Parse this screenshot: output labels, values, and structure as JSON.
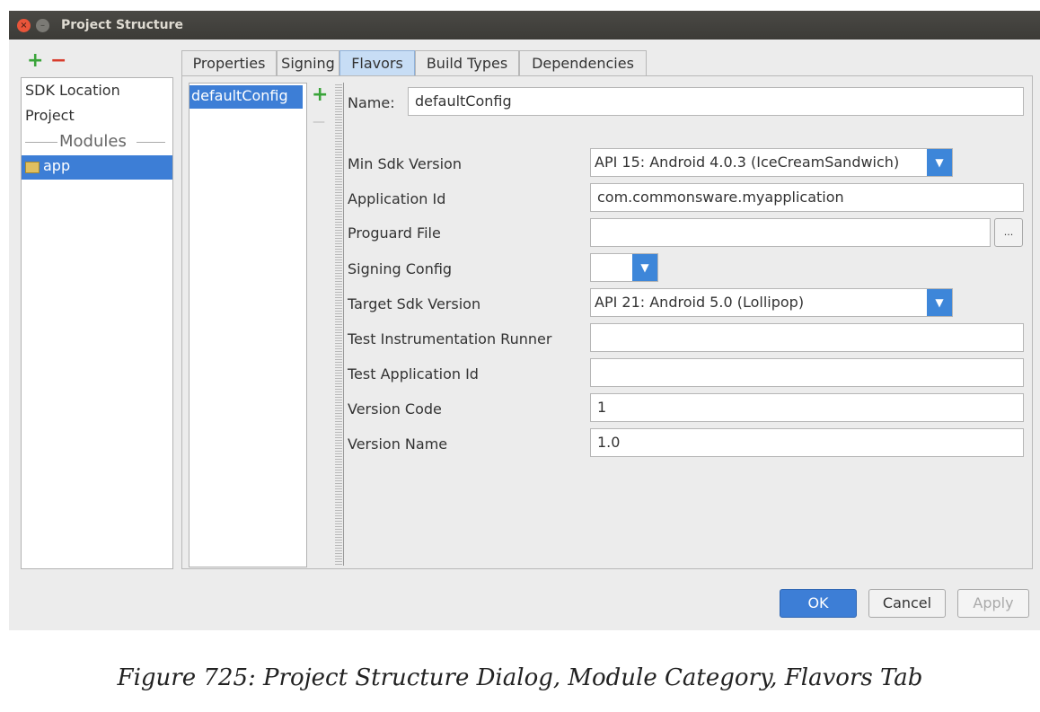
{
  "window": {
    "title": "Project Structure"
  },
  "categories": {
    "add_symbol": "+",
    "remove_symbol": "−",
    "items": [
      "SDK Location",
      "Project"
    ],
    "section_label": "Modules",
    "modules": [
      "app"
    ]
  },
  "tabs": [
    "Properties",
    "Signing",
    "Flavors",
    "Build Types",
    "Dependencies"
  ],
  "selected_tab": "Flavors",
  "flavors": {
    "items": [
      "defaultConfig"
    ],
    "add_symbol": "+",
    "remove_symbol": "—"
  },
  "form": {
    "name_label": "Name:",
    "name_value": "defaultConfig",
    "min_sdk_label": "Min Sdk Version",
    "min_sdk_value": "API 15: Android 4.0.3 (IceCreamSandwich)",
    "app_id_label": "Application Id",
    "app_id_value": "com.commonsware.myapplication",
    "proguard_label": "Proguard File",
    "proguard_value": "",
    "browse_label": "...",
    "signing_label": "Signing Config",
    "signing_value": "",
    "target_sdk_label": "Target Sdk Version",
    "target_sdk_value": "API 21: Android 5.0 (Lollipop)",
    "test_runner_label": "Test Instrumentation Runner",
    "test_runner_value": "",
    "test_app_id_label": "Test Application Id",
    "test_app_id_value": "",
    "version_code_label": "Version Code",
    "version_code_value": "1",
    "version_name_label": "Version Name",
    "version_name_value": "1.0"
  },
  "buttons": {
    "ok": "OK",
    "cancel": "Cancel",
    "apply": "Apply"
  },
  "caption": "Figure 725: Project Structure Dialog, Module Category, Flavors Tab",
  "colors": {
    "accent": "#3d7ed6",
    "titlebar": "#3c3b37",
    "close": "#e9553a",
    "add": "#3aa43a",
    "remove": "#d83c2c"
  },
  "icons": {
    "close": "close-icon",
    "minimize": "minimize-icon",
    "module": "module-folder-icon",
    "dropdown": "chevron-down-icon"
  }
}
